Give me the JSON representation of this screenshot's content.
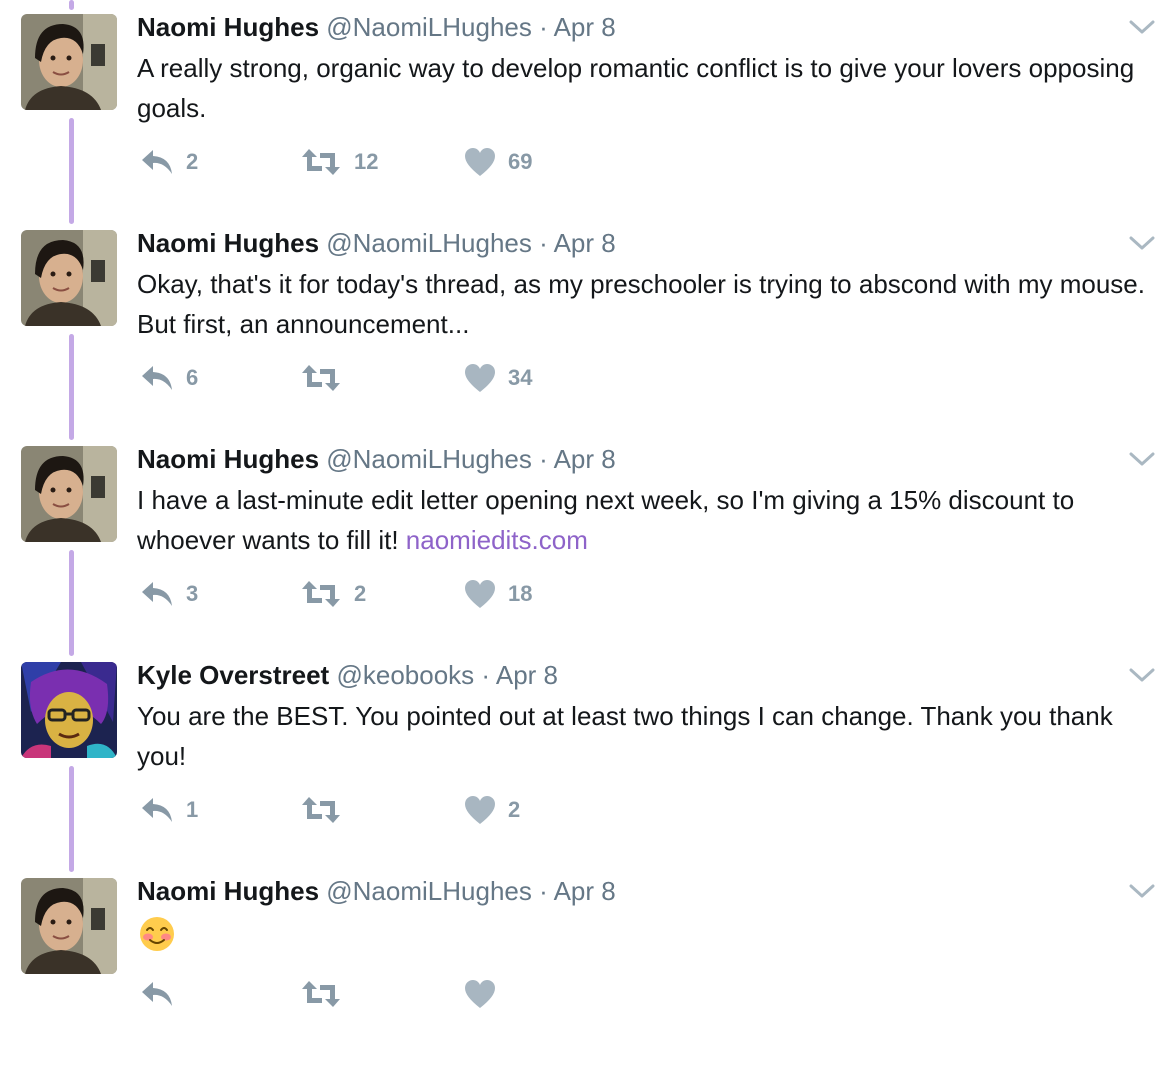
{
  "colors": {
    "thread_line": "#c4a9e6",
    "link": "#8e63c9",
    "meta": "#657786",
    "icon": "#8899a6"
  },
  "tweets": [
    {
      "name": "Naomi Hughes",
      "handle": "@NaomiLHughes",
      "separator": "·",
      "date": "Apr 8",
      "text": "A really strong, organic way to develop romantic conflict is to give your lovers opposing goals.",
      "link": "",
      "reply_count": "2",
      "retweet_count": "12",
      "like_count": "69"
    },
    {
      "name": "Naomi Hughes",
      "handle": "@NaomiLHughes",
      "separator": "·",
      "date": "Apr 8",
      "text": "Okay, that's it for today's thread, as my preschooler is trying to abscond with my mouse. But first, an announcement...",
      "link": "",
      "reply_count": "6",
      "retweet_count": "",
      "like_count": "34"
    },
    {
      "name": "Naomi Hughes",
      "handle": "@NaomiLHughes",
      "separator": "·",
      "date": "Apr 8",
      "text": "I have a last-minute edit letter opening next week, so I'm giving a 15% discount to whoever wants to fill it!",
      "link": "naomiedits.com",
      "reply_count": "3",
      "retweet_count": "2",
      "like_count": "18"
    },
    {
      "name": "Kyle Overstreet",
      "handle": "@keobooks",
      "separator": "·",
      "date": "Apr 8",
      "text": "You are the BEST. You pointed out at least two things I can change. Thank you thank you!",
      "link": "",
      "reply_count": "1",
      "retweet_count": "",
      "like_count": "2"
    },
    {
      "name": "Naomi Hughes",
      "handle": "@NaomiLHughes",
      "separator": "·",
      "date": "Apr 8",
      "text": "",
      "emoji": "smiling-face-with-smiling-eyes-emoji",
      "link": "",
      "reply_count": "",
      "retweet_count": "",
      "like_count": ""
    }
  ]
}
